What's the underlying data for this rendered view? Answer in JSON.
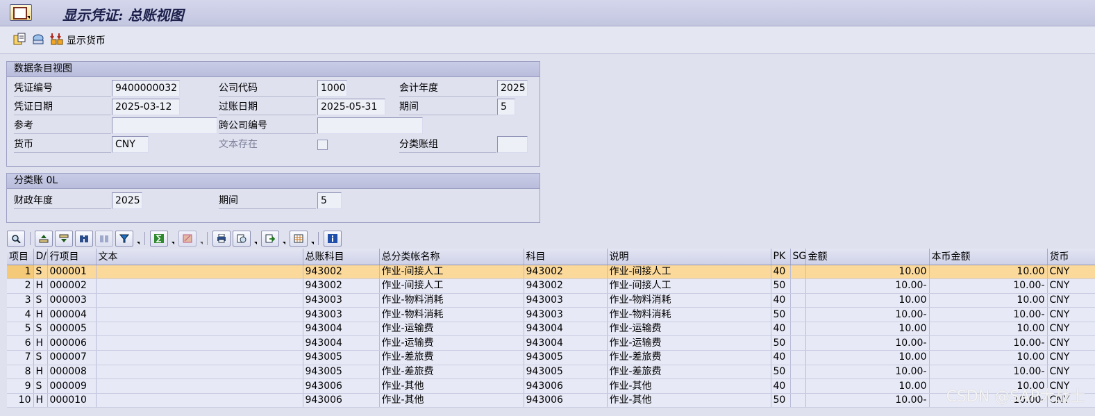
{
  "window": {
    "title": "显示凭证: 总账视图"
  },
  "toolbar": {
    "currency_label": "显示货币"
  },
  "header_group": {
    "title": "数据条目视图",
    "doc_no_label": "凭证编号",
    "doc_no": "9400000032",
    "company_label": "公司代码",
    "company": "1000",
    "fiscal_year_label": "会计年度",
    "fiscal_year": "2025",
    "doc_date_label": "凭证日期",
    "doc_date": "2025-03-12",
    "post_date_label": "过账日期",
    "post_date": "2025-05-31",
    "period_label": "期间",
    "period": "5",
    "reference_label": "参考",
    "reference": "",
    "intercompany_label": "跨公司编号",
    "intercompany": "",
    "currency_label": "货币",
    "currency": "CNY",
    "text_exists_label": "文本存在",
    "ledger_group_label": "分类账组",
    "ledger_group": ""
  },
  "ledger_group": {
    "title": "分类账 0L",
    "fiscal_year_label": "财政年度",
    "fiscal_year": "2025",
    "period_label": "期间",
    "period": "5"
  },
  "table": {
    "columns": [
      "项目",
      "D/",
      "行项目",
      "文本",
      "总账科目",
      "总分类帐名称",
      "科目",
      "说明",
      "PK",
      "SG",
      "金额",
      "本币金额",
      "货币"
    ],
    "rows": [
      [
        "1",
        "S",
        "000001",
        "",
        "943002",
        "作业-间接人工",
        "943002",
        "作业-间接人工",
        "40",
        "",
        "10.00",
        "10.00",
        "CNY"
      ],
      [
        "2",
        "H",
        "000002",
        "",
        "943002",
        "作业-间接人工",
        "943002",
        "作业-间接人工",
        "50",
        "",
        "10.00-",
        "10.00-",
        "CNY"
      ],
      [
        "3",
        "S",
        "000003",
        "",
        "943003",
        "作业-物料消耗",
        "943003",
        "作业-物料消耗",
        "40",
        "",
        "10.00",
        "10.00",
        "CNY"
      ],
      [
        "4",
        "H",
        "000004",
        "",
        "943003",
        "作业-物料消耗",
        "943003",
        "作业-物料消耗",
        "50",
        "",
        "10.00-",
        "10.00-",
        "CNY"
      ],
      [
        "5",
        "S",
        "000005",
        "",
        "943004",
        "作业-运输费",
        "943004",
        "作业-运输费",
        "40",
        "",
        "10.00",
        "10.00",
        "CNY"
      ],
      [
        "6",
        "H",
        "000006",
        "",
        "943004",
        "作业-运输费",
        "943004",
        "作业-运输费",
        "50",
        "",
        "10.00-",
        "10.00-",
        "CNY"
      ],
      [
        "7",
        "S",
        "000007",
        "",
        "943005",
        "作业-差旅费",
        "943005",
        "作业-差旅费",
        "40",
        "",
        "10.00",
        "10.00",
        "CNY"
      ],
      [
        "8",
        "H",
        "000008",
        "",
        "943005",
        "作业-差旅费",
        "943005",
        "作业-差旅费",
        "50",
        "",
        "10.00-",
        "10.00-",
        "CNY"
      ],
      [
        "9",
        "S",
        "000009",
        "",
        "943006",
        "作业-其他",
        "943006",
        "作业-其他",
        "40",
        "",
        "10.00",
        "10.00",
        "CNY"
      ],
      [
        "10",
        "H",
        "000010",
        "",
        "943006",
        "作业-其他",
        "943006",
        "作业-其他",
        "50",
        "",
        "10.00-",
        "10.00-",
        "CNY"
      ]
    ]
  },
  "watermark": "CSDN @SAP大战士"
}
